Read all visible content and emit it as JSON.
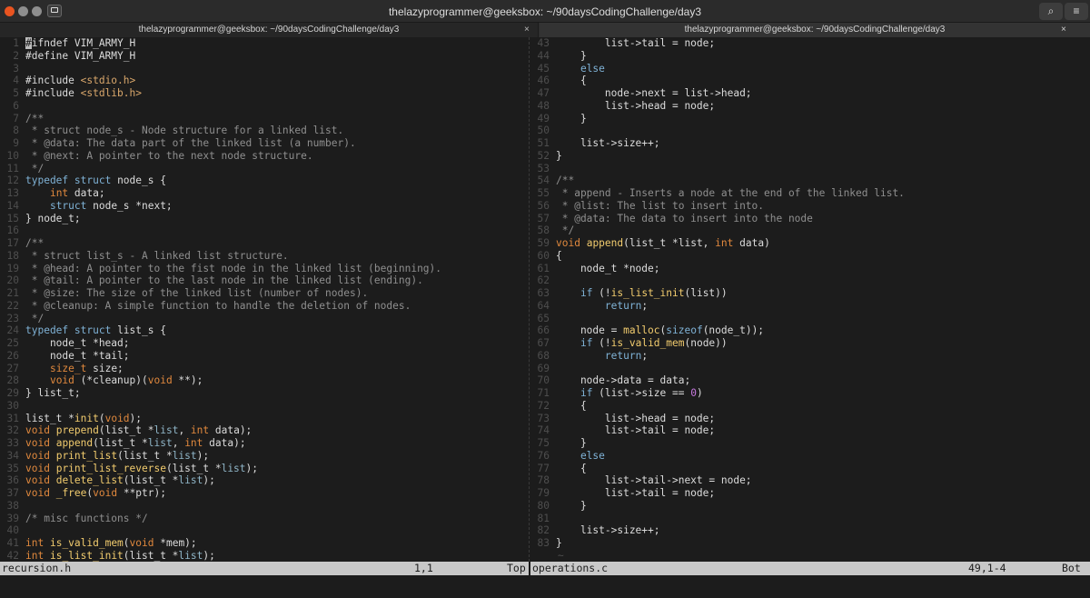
{
  "window": {
    "title": "thelazyprogrammer@geeksbox: ~/90daysCodingChallenge/day3"
  },
  "titlebar_buttons": {
    "search_icon": "⌕",
    "menu_icon": "≡"
  },
  "tabs": [
    {
      "label": "thelazyprogrammer@geeksbox: ~/90daysCodingChallenge/day3",
      "close": "×"
    },
    {
      "label": "thelazyprogrammer@geeksbox: ~/90daysCodingChallenge/day3",
      "close": "×"
    }
  ],
  "panes": {
    "left": {
      "lines": [
        {
          "n": "1",
          "s": [
            [
              "n",
              "#ifndef VIM_ARMY_H"
            ]
          ]
        },
        {
          "n": "2",
          "s": [
            [
              "n",
              "#define VIM_ARMY_H"
            ]
          ]
        },
        {
          "n": "3",
          "s": []
        },
        {
          "n": "4",
          "s": [
            [
              "n",
              "#include "
            ],
            [
              "s",
              "<stdio.h>"
            ]
          ]
        },
        {
          "n": "5",
          "s": [
            [
              "n",
              "#include "
            ],
            [
              "s",
              "<stdlib.h>"
            ]
          ]
        },
        {
          "n": "6",
          "s": []
        },
        {
          "n": "7",
          "s": [
            [
              "c",
              "/**"
            ]
          ]
        },
        {
          "n": "8",
          "s": [
            [
              "c",
              " * struct node_s - Node structure for a linked list."
            ]
          ]
        },
        {
          "n": "9",
          "s": [
            [
              "c",
              " * @data: The data part of the linked list (a number)."
            ]
          ]
        },
        {
          "n": "10",
          "s": [
            [
              "c",
              " * @next: A pointer to the next node structure."
            ]
          ]
        },
        {
          "n": "11",
          "s": [
            [
              "c",
              " */"
            ]
          ]
        },
        {
          "n": "12",
          "s": [
            [
              "k",
              "typedef"
            ],
            [
              "n",
              " "
            ],
            [
              "k",
              "struct"
            ],
            [
              "n",
              " node_s {"
            ]
          ]
        },
        {
          "n": "13",
          "s": [
            [
              "n",
              "    "
            ],
            [
              "t",
              "int"
            ],
            [
              "n",
              " data;"
            ]
          ]
        },
        {
          "n": "14",
          "s": [
            [
              "n",
              "    "
            ],
            [
              "k",
              "struct"
            ],
            [
              "n",
              " node_s *next;"
            ]
          ]
        },
        {
          "n": "15",
          "s": [
            [
              "n",
              "} node_t;"
            ]
          ]
        },
        {
          "n": "16",
          "s": []
        },
        {
          "n": "17",
          "s": [
            [
              "c",
              "/**"
            ]
          ]
        },
        {
          "n": "18",
          "s": [
            [
              "c",
              " * struct list_s - A linked list structure."
            ]
          ]
        },
        {
          "n": "19",
          "s": [
            [
              "c",
              " * @head: A pointer to the fist node in the linked list (beginning)."
            ]
          ]
        },
        {
          "n": "20",
          "s": [
            [
              "c",
              " * @tail: A pointer to the last node in the linked list (ending)."
            ]
          ]
        },
        {
          "n": "21",
          "s": [
            [
              "c",
              " * @size: The size of the linked list (number of nodes)."
            ]
          ]
        },
        {
          "n": "22",
          "s": [
            [
              "c",
              " * @cleanup: A simple function to handle the deletion of nodes."
            ]
          ]
        },
        {
          "n": "23",
          "s": [
            [
              "c",
              " */"
            ]
          ]
        },
        {
          "n": "24",
          "s": [
            [
              "k",
              "typedef"
            ],
            [
              "n",
              " "
            ],
            [
              "k",
              "struct"
            ],
            [
              "n",
              " list_s {"
            ]
          ]
        },
        {
          "n": "25",
          "s": [
            [
              "n",
              "    node_t *head;"
            ]
          ]
        },
        {
          "n": "26",
          "s": [
            [
              "n",
              "    node_t *tail;"
            ]
          ]
        },
        {
          "n": "27",
          "s": [
            [
              "n",
              "    "
            ],
            [
              "t",
              "size_t"
            ],
            [
              "n",
              " size;"
            ]
          ]
        },
        {
          "n": "28",
          "s": [
            [
              "n",
              "    "
            ],
            [
              "t",
              "void"
            ],
            [
              "n",
              " (*cleanup)("
            ],
            [
              "t",
              "void"
            ],
            [
              "n",
              " **);"
            ]
          ]
        },
        {
          "n": "29",
          "s": [
            [
              "n",
              "} list_t;"
            ]
          ]
        },
        {
          "n": "30",
          "s": []
        },
        {
          "n": "31",
          "s": [
            [
              "n",
              "list_t *"
            ],
            [
              "f",
              "init"
            ],
            [
              "n",
              "("
            ],
            [
              "t",
              "void"
            ],
            [
              "n",
              ");"
            ]
          ]
        },
        {
          "n": "32",
          "s": [
            [
              "t",
              "void"
            ],
            [
              "n",
              " "
            ],
            [
              "f",
              "prepend"
            ],
            [
              "n",
              "(list_t *"
            ],
            [
              "p",
              "list"
            ],
            [
              "n",
              ", "
            ],
            [
              "t",
              "int"
            ],
            [
              "n",
              " data);"
            ]
          ]
        },
        {
          "n": "33",
          "s": [
            [
              "t",
              "void"
            ],
            [
              "n",
              " "
            ],
            [
              "f",
              "append"
            ],
            [
              "n",
              "(list_t *"
            ],
            [
              "p",
              "list"
            ],
            [
              "n",
              ", "
            ],
            [
              "t",
              "int"
            ],
            [
              "n",
              " data);"
            ]
          ]
        },
        {
          "n": "34",
          "s": [
            [
              "t",
              "void"
            ],
            [
              "n",
              " "
            ],
            [
              "f",
              "print_list"
            ],
            [
              "n",
              "(list_t *"
            ],
            [
              "p",
              "list"
            ],
            [
              "n",
              ");"
            ]
          ]
        },
        {
          "n": "35",
          "s": [
            [
              "t",
              "void"
            ],
            [
              "n",
              " "
            ],
            [
              "f",
              "print_list_reverse"
            ],
            [
              "n",
              "(list_t *"
            ],
            [
              "p",
              "list"
            ],
            [
              "n",
              ");"
            ]
          ]
        },
        {
          "n": "36",
          "s": [
            [
              "t",
              "void"
            ],
            [
              "n",
              " "
            ],
            [
              "f",
              "delete_list"
            ],
            [
              "n",
              "(list_t *"
            ],
            [
              "p",
              "list"
            ],
            [
              "n",
              ");"
            ]
          ]
        },
        {
          "n": "37",
          "s": [
            [
              "t",
              "void"
            ],
            [
              "n",
              " "
            ],
            [
              "f",
              "_free"
            ],
            [
              "n",
              "("
            ],
            [
              "t",
              "void"
            ],
            [
              "n",
              " **ptr);"
            ]
          ]
        },
        {
          "n": "38",
          "s": []
        },
        {
          "n": "39",
          "s": [
            [
              "c",
              "/* misc functions */"
            ]
          ]
        },
        {
          "n": "40",
          "s": []
        },
        {
          "n": "41",
          "s": [
            [
              "t",
              "int"
            ],
            [
              "n",
              " "
            ],
            [
              "f",
              "is_valid_mem"
            ],
            [
              "n",
              "("
            ],
            [
              "t",
              "void"
            ],
            [
              "n",
              " *mem);"
            ]
          ]
        },
        {
          "n": "42",
          "s": [
            [
              "t",
              "int"
            ],
            [
              "n",
              " "
            ],
            [
              "f",
              "is_list_init"
            ],
            [
              "n",
              "(list_t *"
            ],
            [
              "p",
              "list"
            ],
            [
              "n",
              ");"
            ]
          ]
        }
      ]
    },
    "right": {
      "lines": [
        {
          "n": "43",
          "s": [
            [
              "n",
              "        list->tail = node;"
            ]
          ]
        },
        {
          "n": "44",
          "s": [
            [
              "n",
              "    }"
            ]
          ]
        },
        {
          "n": "45",
          "s": [
            [
              "n",
              "    "
            ],
            [
              "k",
              "else"
            ]
          ]
        },
        {
          "n": "46",
          "s": [
            [
              "n",
              "    {"
            ]
          ]
        },
        {
          "n": "47",
          "s": [
            [
              "n",
              "        node->next = list->head;"
            ]
          ]
        },
        {
          "n": "48",
          "s": [
            [
              "n",
              "        list->head = node;"
            ]
          ]
        },
        {
          "n": "49",
          "s": [
            [
              "n",
              "    }"
            ]
          ]
        },
        {
          "n": "50",
          "s": []
        },
        {
          "n": "51",
          "s": [
            [
              "n",
              "    list->size++;"
            ]
          ]
        },
        {
          "n": "52",
          "s": [
            [
              "n",
              "}"
            ]
          ]
        },
        {
          "n": "53",
          "s": []
        },
        {
          "n": "54",
          "s": [
            [
              "c",
              "/**"
            ]
          ]
        },
        {
          "n": "55",
          "s": [
            [
              "c",
              " * append - Inserts a node at the end of the linked list."
            ]
          ]
        },
        {
          "n": "56",
          "s": [
            [
              "c",
              " * @list: The list to insert into."
            ]
          ]
        },
        {
          "n": "57",
          "s": [
            [
              "c",
              " * @data: The data to insert into the node"
            ]
          ]
        },
        {
          "n": "58",
          "s": [
            [
              "c",
              " */"
            ]
          ]
        },
        {
          "n": "59",
          "s": [
            [
              "t",
              "void"
            ],
            [
              "n",
              " "
            ],
            [
              "f",
              "append"
            ],
            [
              "n",
              "(list_t *list, "
            ],
            [
              "t",
              "int"
            ],
            [
              "n",
              " data)"
            ]
          ]
        },
        {
          "n": "60",
          "s": [
            [
              "n",
              "{"
            ]
          ]
        },
        {
          "n": "61",
          "s": [
            [
              "n",
              "    node_t *node;"
            ]
          ]
        },
        {
          "n": "62",
          "s": []
        },
        {
          "n": "63",
          "s": [
            [
              "n",
              "    "
            ],
            [
              "k",
              "if"
            ],
            [
              "n",
              " (!"
            ],
            [
              "f",
              "is_list_init"
            ],
            [
              "n",
              "(list))"
            ]
          ]
        },
        {
          "n": "64",
          "s": [
            [
              "n",
              "        "
            ],
            [
              "r",
              "return"
            ],
            [
              "n",
              ";"
            ]
          ]
        },
        {
          "n": "65",
          "s": []
        },
        {
          "n": "66",
          "s": [
            [
              "n",
              "    node = "
            ],
            [
              "f",
              "malloc"
            ],
            [
              "n",
              "("
            ],
            [
              "k",
              "sizeof"
            ],
            [
              "n",
              "(node_t));"
            ]
          ]
        },
        {
          "n": "67",
          "s": [
            [
              "n",
              "    "
            ],
            [
              "k",
              "if"
            ],
            [
              "n",
              " (!"
            ],
            [
              "f",
              "is_valid_mem"
            ],
            [
              "n",
              "(node))"
            ]
          ]
        },
        {
          "n": "68",
          "s": [
            [
              "n",
              "        "
            ],
            [
              "r",
              "return"
            ],
            [
              "n",
              ";"
            ]
          ]
        },
        {
          "n": "69",
          "s": []
        },
        {
          "n": "70",
          "s": [
            [
              "n",
              "    node->data = data;"
            ]
          ]
        },
        {
          "n": "71",
          "s": [
            [
              "n",
              "    "
            ],
            [
              "k",
              "if"
            ],
            [
              "n",
              " (list->size == "
            ],
            [
              "m",
              "0"
            ],
            [
              "n",
              ")"
            ]
          ]
        },
        {
          "n": "72",
          "s": [
            [
              "n",
              "    {"
            ]
          ]
        },
        {
          "n": "73",
          "s": [
            [
              "n",
              "        list->head = node;"
            ]
          ]
        },
        {
          "n": "74",
          "s": [
            [
              "n",
              "        list->tail = node;"
            ]
          ]
        },
        {
          "n": "75",
          "s": [
            [
              "n",
              "    }"
            ]
          ]
        },
        {
          "n": "76",
          "s": [
            [
              "n",
              "    "
            ],
            [
              "k",
              "else"
            ]
          ]
        },
        {
          "n": "77",
          "s": [
            [
              "n",
              "    {"
            ]
          ]
        },
        {
          "n": "78",
          "s": [
            [
              "n",
              "        list->tail->next = node;"
            ]
          ]
        },
        {
          "n": "79",
          "s": [
            [
              "n",
              "        list->tail = node;"
            ]
          ]
        },
        {
          "n": "80",
          "s": [
            [
              "n",
              "    }"
            ]
          ]
        },
        {
          "n": "81",
          "s": []
        },
        {
          "n": "82",
          "s": [
            [
              "n",
              "    list->size++;"
            ]
          ]
        },
        {
          "n": "83",
          "s": [
            [
              "n",
              "}"
            ]
          ]
        },
        {
          "n": "",
          "s": [
            [
              "tilde",
              "~"
            ]
          ]
        }
      ]
    }
  },
  "status": {
    "left": {
      "file": "recursion.h",
      "position": "1,1",
      "scroll": "Top"
    },
    "right": {
      "file": "operations.c",
      "position": "49,1-4",
      "scroll": "Bot"
    }
  },
  "colors": {
    "background": "#1c1c1c",
    "comment": "#8f8f8f",
    "keyword": "#7fb2d6",
    "type": "#e0883d",
    "function": "#f2cc6e",
    "string": "#d9a76b",
    "close_button": "#e95420",
    "statusbar": "#c8c8c8"
  }
}
